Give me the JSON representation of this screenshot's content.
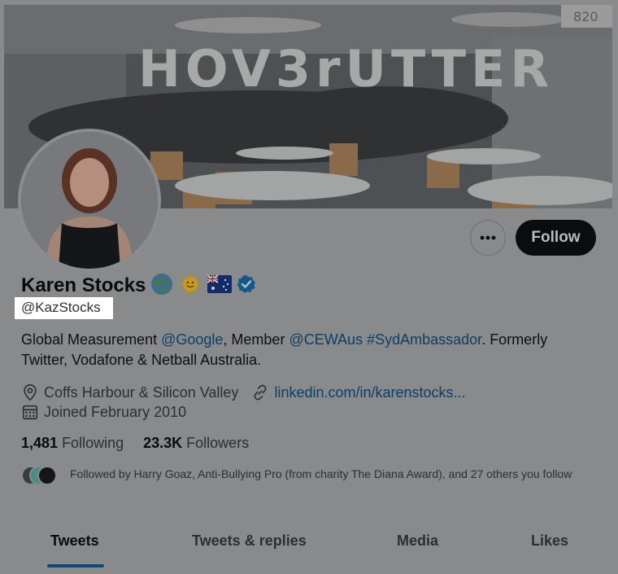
{
  "banner": {
    "balloon_text": "HOV3rUTTER",
    "sign_text": "820"
  },
  "profile": {
    "name": "Karen Stocks",
    "handle": "@KazStocks",
    "emojis": [
      "globe-icon",
      "sun-icon",
      "australia-flag-icon",
      "verified-badge-icon"
    ],
    "bio": {
      "part1": "Global Measurement ",
      "mention1": "@Google",
      "part2": ", Member ",
      "mention2": "@CEWAus",
      "part3": " ",
      "mention3": "#SydAmbassador",
      "part4": ". Formerly Twitter, Vodafone & Netball Australia."
    },
    "location": "Coffs Harbour & Silicon Valley",
    "url": "linkedin.com/in/karenstocks...",
    "joined": "Joined February 2010",
    "following_count": "1,481",
    "following_label": "Following",
    "followers_count": "23.3K",
    "followers_label": "Followers",
    "followed_by": "Followed by Harry Goaz, Anti-Bullying Pro (from charity The Diana Award), and 27 others you follow"
  },
  "actions": {
    "follow_label": "Follow"
  },
  "tabs": [
    {
      "label": "Tweets",
      "active": true
    },
    {
      "label": "Tweets & replies",
      "active": false
    },
    {
      "label": "Media",
      "active": false
    },
    {
      "label": "Likes",
      "active": false
    }
  ],
  "colors": {
    "accent": "#1d9bf0",
    "follow_bg": "#0f1419"
  }
}
